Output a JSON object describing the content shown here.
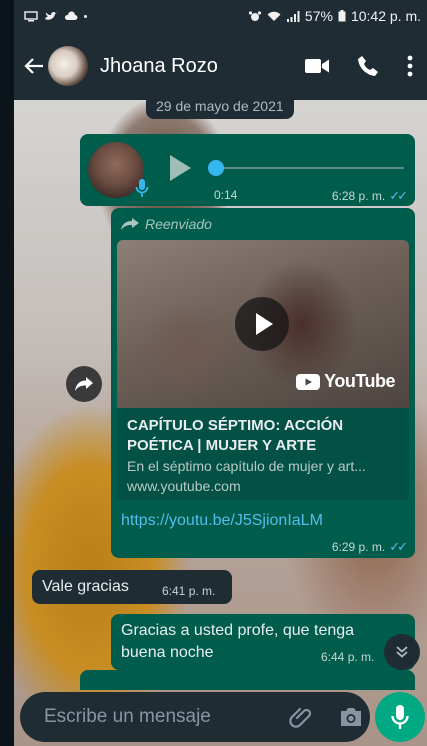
{
  "status_bar": {
    "battery": "57%",
    "time": "10:42 p. m."
  },
  "header": {
    "contact_name": "Jhoana Rozo"
  },
  "chat": {
    "date_divider": "29 de mayo de 2021",
    "audio_message": {
      "duration": "0:14",
      "time": "6:28 p. m.",
      "progress": 0
    },
    "forwarded_message": {
      "forwarded_label": "Reenviado",
      "link_brand": "YouTube",
      "link_title": "CAPÍTULO SÉPTIMO: ACCIÓN POÉTICA | MUJER Y ARTE",
      "link_description": "En el séptimo capítulo de mujer y art...",
      "link_domain": "www.youtube.com",
      "url": "https://youtu.be/J5SjionIaLM",
      "time": "6:29 p. m."
    },
    "incoming_message": {
      "text": "Vale gracias",
      "time": "6:41 p. m."
    },
    "outgoing_message": {
      "text": "Gracias a usted profe, que tenga buena noche",
      "time": "6:44 p. m."
    }
  },
  "composer": {
    "placeholder": "Escribe un mensaje"
  },
  "colors": {
    "header": "#1f2c34",
    "outgoing_bubble": "#005c4b",
    "incoming_bubble": "#1f2c34",
    "accent": "#00a884",
    "read_ticks": "#53bdeb"
  }
}
